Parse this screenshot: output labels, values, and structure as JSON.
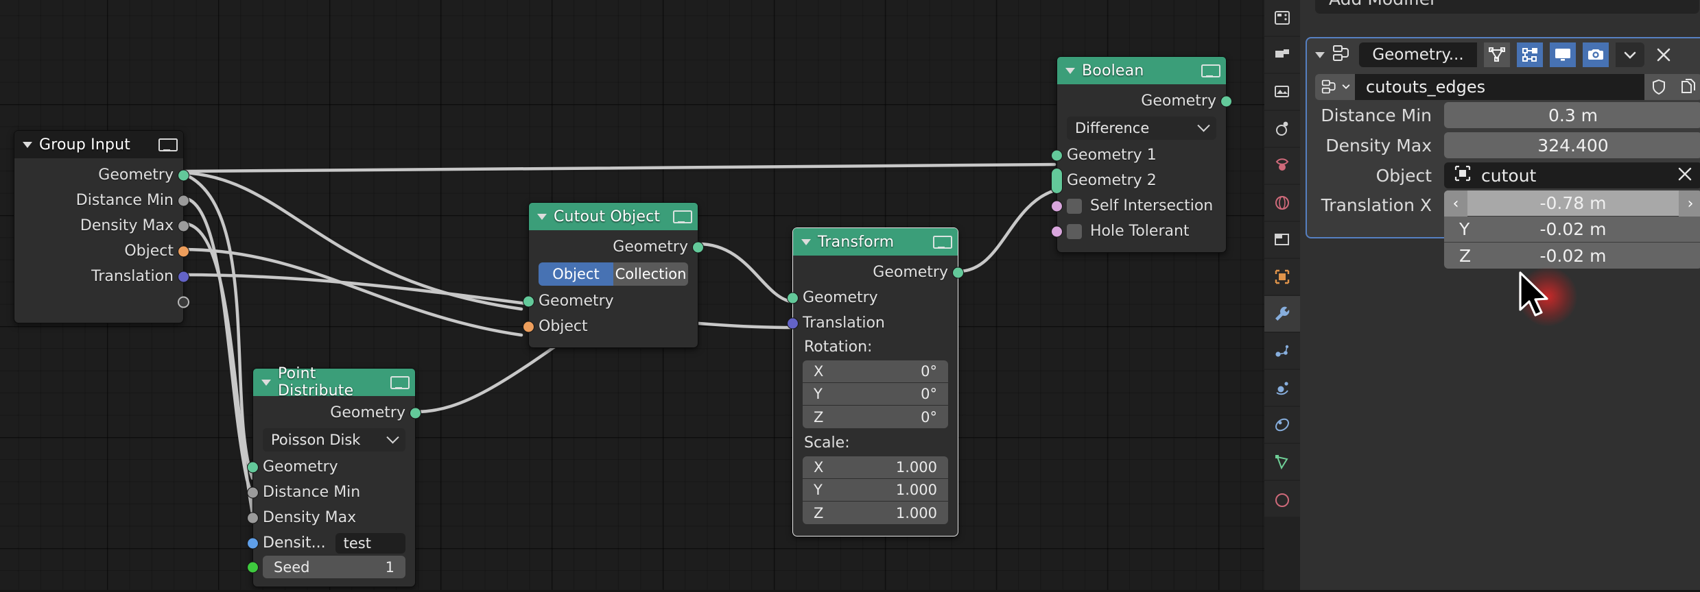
{
  "node_editor": {
    "nodes": [
      {
        "id": "group-input",
        "title": "Group Input",
        "header_style": "grey",
        "outputs": [
          "Geometry",
          "Distance Min",
          "Density Max",
          "Object",
          "Translation",
          ""
        ]
      },
      {
        "id": "cutout-object",
        "title": "Cutout Object",
        "header_style": "green",
        "outputs": [
          "Geometry"
        ],
        "toggle": {
          "on": "Object",
          "off": "Collection"
        },
        "inputs": [
          "Geometry",
          "Object"
        ]
      },
      {
        "id": "point-distribute",
        "title": "Point Distribute",
        "header_style": "green",
        "outputs": [
          "Geometry"
        ],
        "dropdown": "Poisson Disk",
        "inputs": [
          "Geometry",
          "Distance Min",
          "Density Max",
          "Densit..."
        ],
        "density_value": "test",
        "seed_label": "Seed",
        "seed_value": "1"
      },
      {
        "id": "transform",
        "title": "Transform",
        "header_style": "green",
        "outputs": [
          "Geometry"
        ],
        "inputs": [
          "Geometry",
          "Translation"
        ],
        "rotation_label": "Rotation:",
        "rotation": [
          {
            "axis": "X",
            "value": "0°"
          },
          {
            "axis": "Y",
            "value": "0°"
          },
          {
            "axis": "Z",
            "value": "0°"
          }
        ],
        "scale_label": "Scale:",
        "scale": [
          {
            "axis": "X",
            "value": "1.000"
          },
          {
            "axis": "Y",
            "value": "1.000"
          },
          {
            "axis": "Z",
            "value": "1.000"
          }
        ]
      },
      {
        "id": "boolean",
        "title": "Boolean",
        "header_style": "green",
        "outputs": [
          "Geometry"
        ],
        "dropdown": "Difference",
        "inputs": [
          "Geometry 1",
          "Geometry 2"
        ],
        "checkboxes": [
          {
            "label": "Self Intersection",
            "checked": false
          },
          {
            "label": "Hole Tolerant",
            "checked": false
          }
        ]
      }
    ]
  },
  "properties": {
    "add_modifier_label": "Add Modifier",
    "modifier": {
      "name_field": "Geometry...",
      "header_icons": [
        {
          "name": "edit-mode-display-icon",
          "active": false
        },
        {
          "name": "realtime-display-icon",
          "active": true
        },
        {
          "name": "viewport-display-icon",
          "active": true
        },
        {
          "name": "render-display-icon",
          "active": true
        },
        {
          "name": "dropdown-menu-icon",
          "active": false
        },
        {
          "name": "close-icon",
          "active": false
        }
      ],
      "node_group_name": "cutouts_edges",
      "fields": [
        {
          "label": "Distance Min",
          "value": "0.3 m"
        },
        {
          "label": "Density Max",
          "value": "324.400"
        }
      ],
      "object_field": {
        "label": "Object",
        "value": "cutout"
      },
      "translation": {
        "label": "Translation X",
        "rows": [
          {
            "axis": "Translation X",
            "value": "-0.78 m",
            "active": true
          },
          {
            "axis": "Y",
            "value": "-0.02 m",
            "active": false
          },
          {
            "axis": "Z",
            "value": "-0.02 m",
            "active": false
          }
        ]
      }
    },
    "tabs": [
      {
        "name": "tool-tab",
        "active": false
      },
      {
        "name": "render-tab",
        "active": false
      },
      {
        "name": "output-tab",
        "active": false
      },
      {
        "name": "view-layer-tab",
        "active": false
      },
      {
        "name": "scene-tab",
        "active": false
      },
      {
        "name": "world-tab",
        "active": false
      },
      {
        "name": "collection-tab",
        "active": false
      },
      {
        "name": "object-tab",
        "active": false
      },
      {
        "name": "modifier-tab",
        "active": true
      },
      {
        "name": "particles-tab",
        "active": false
      },
      {
        "name": "physics-tab",
        "active": false
      },
      {
        "name": "constraints-tab",
        "active": false
      },
      {
        "name": "object-data-tab",
        "active": false
      }
    ]
  },
  "colors": {
    "node_header_green": "#3b9e79",
    "node_header_grey": "#1c1c1c",
    "node_body": "#2e2e2e",
    "editor_bg": "#1d1d1d",
    "accent_blue": "#4772b3",
    "socket_geometry": "#63c99a",
    "socket_object": "#ed9e5c",
    "socket_vector": "#6363c7",
    "socket_grey": "#9b9b9b",
    "socket_pink": "#d9a6dd",
    "panel_bg": "#303030",
    "drag_highlight": "#e22828"
  }
}
